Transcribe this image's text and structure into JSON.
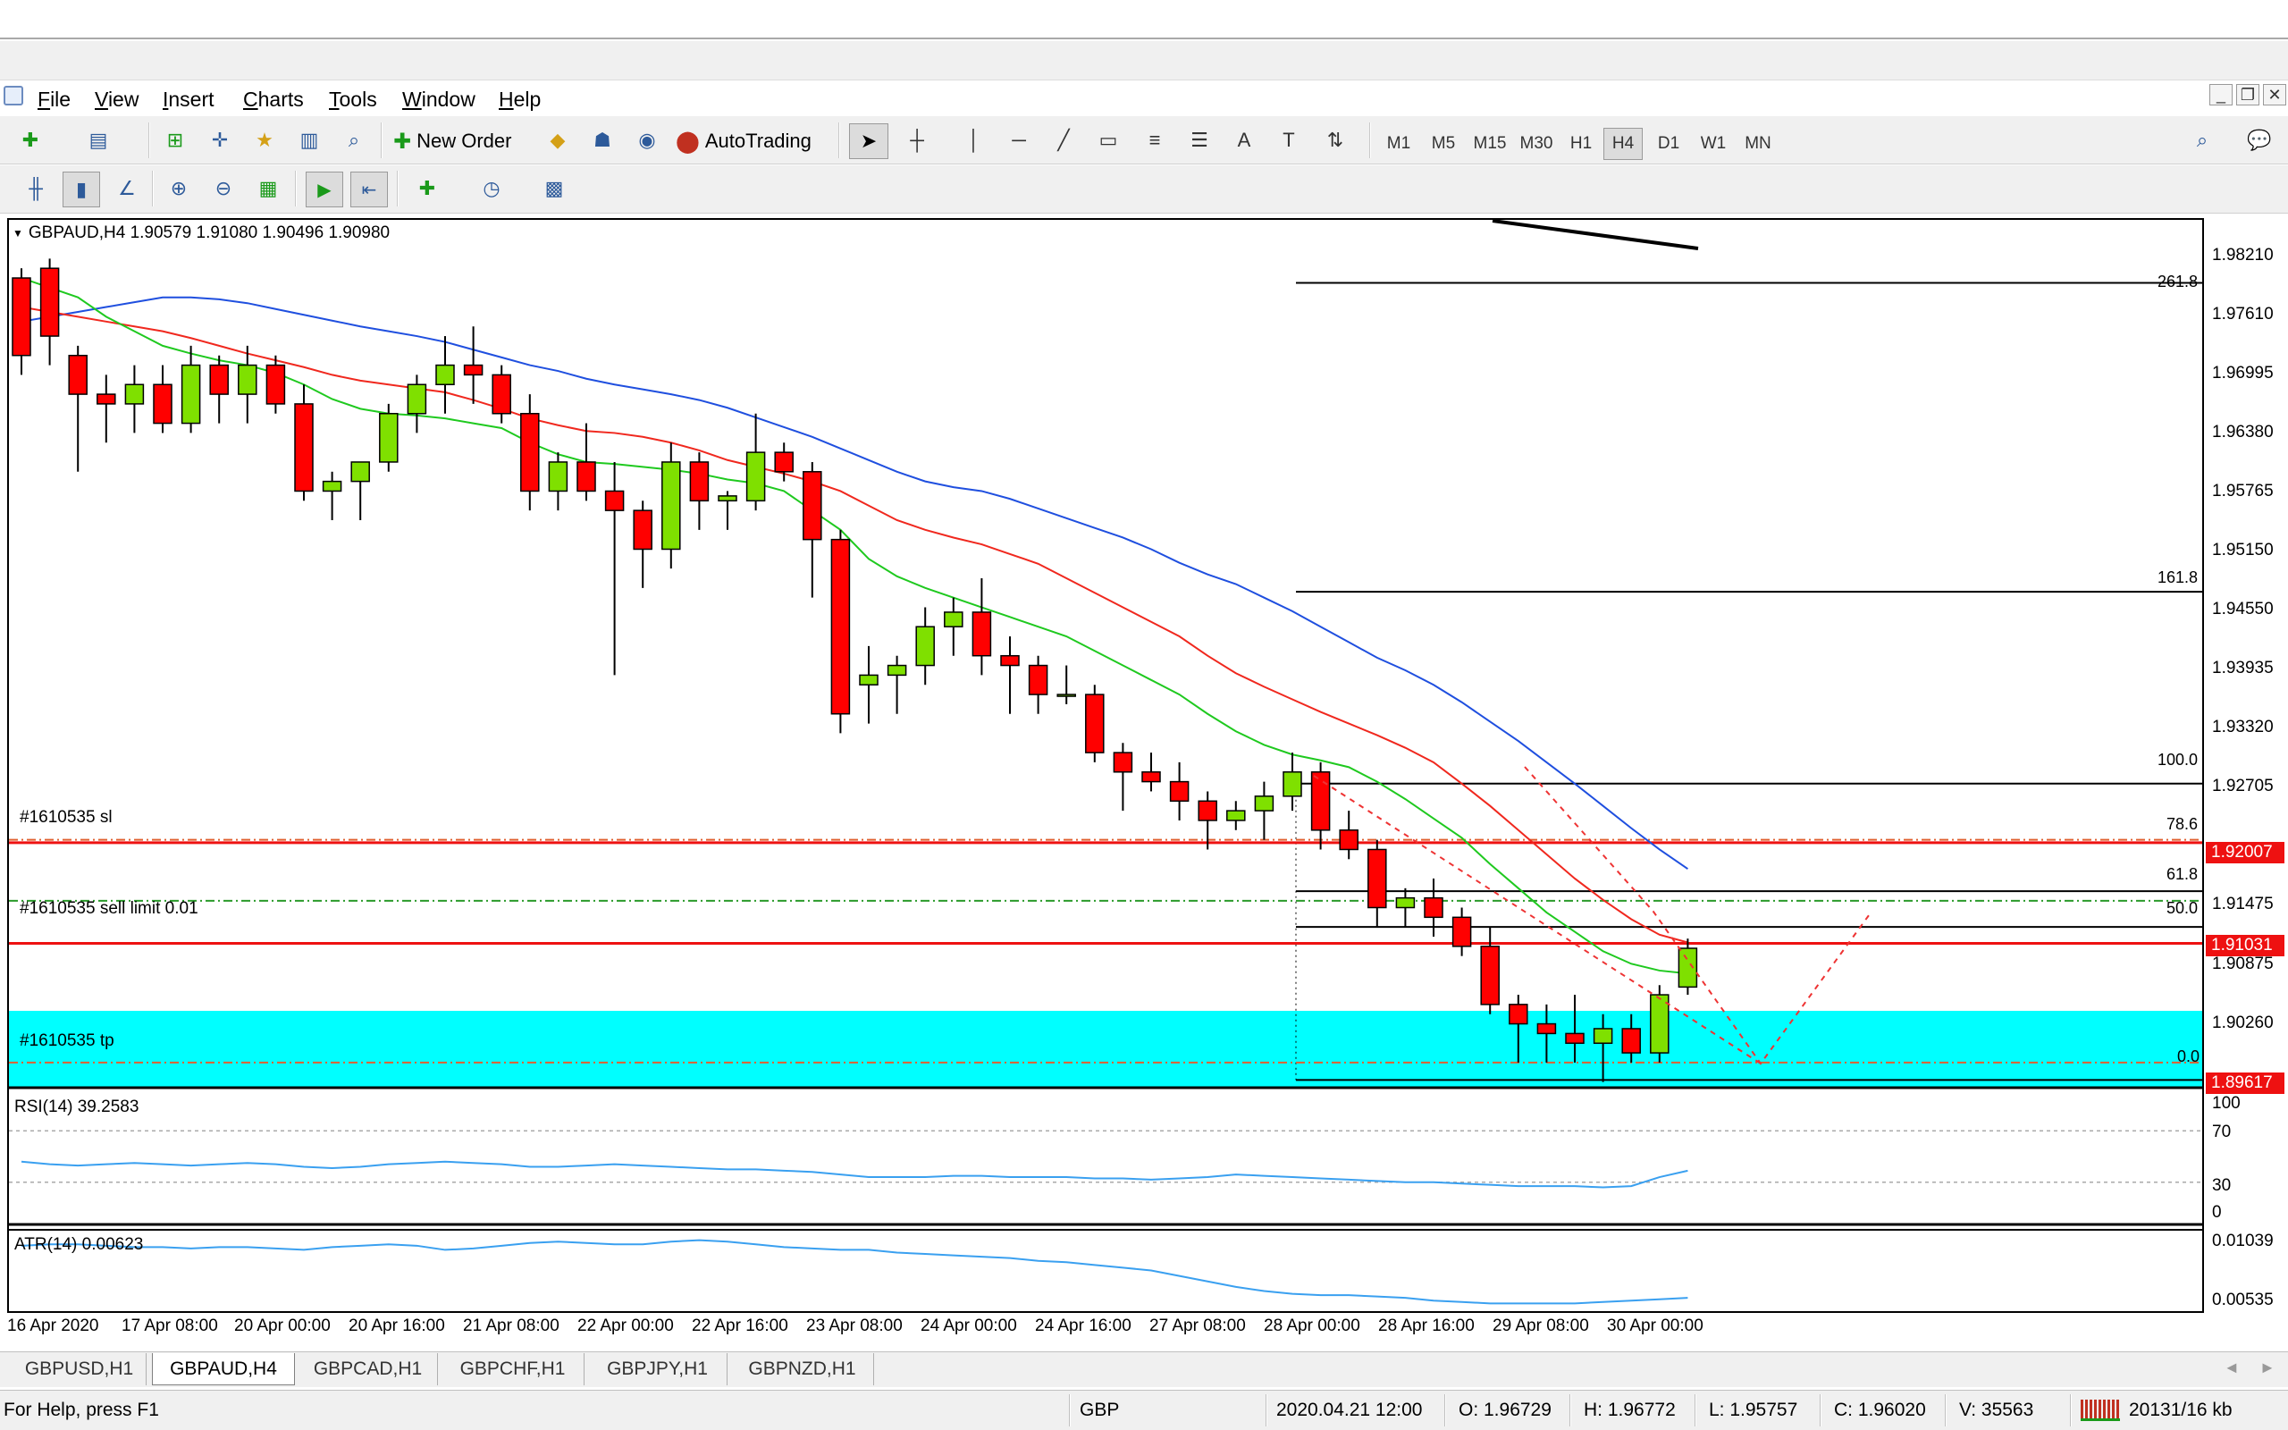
{
  "menu": [
    "File",
    "View",
    "Insert",
    "Charts",
    "Tools",
    "Window",
    "Help"
  ],
  "toolbar": {
    "new_order_label": "New Order",
    "autotrading_label": "AutoTrading",
    "timeframes": [
      "M1",
      "M5",
      "M15",
      "M30",
      "H1",
      "H4",
      "D1",
      "W1",
      "MN"
    ],
    "active_timeframe": "H4"
  },
  "chart": {
    "header": "GBPAUD,H4  1.90579 1.91080 1.90496 1.90980",
    "price_axis": [
      "1.98210",
      "1.97610",
      "1.96995",
      "1.96380",
      "1.95765",
      "1.95150",
      "1.94550",
      "1.93935",
      "1.93320",
      "1.92705",
      "1.92090",
      "1.91475",
      "1.90875",
      "1.90260"
    ],
    "price_tags": {
      "sl": "1.92007",
      "bid": "1.91031",
      "tp": "1.89617"
    },
    "fib_levels": [
      "261.8",
      "161.8",
      "100.0",
      "78.6",
      "61.8",
      "50.0",
      "0.0"
    ],
    "order_labels": {
      "sl": "#1610535 sl",
      "sell_limit": "#1610535 sell limit 0.01",
      "tp": "#1610535 tp"
    },
    "rsi_label": "RSI(14) 39.2583",
    "rsi_axis": [
      "100",
      "70",
      "30",
      "0"
    ],
    "atr_label": "ATR(14) 0.00623",
    "atr_axis": [
      "0.01039",
      "0.00535"
    ],
    "time_axis": [
      "16 Apr 2020",
      "17 Apr 08:00",
      "20 Apr 00:00",
      "20 Apr 16:00",
      "21 Apr 08:00",
      "22 Apr 00:00",
      "22 Apr 16:00",
      "23 Apr 08:00",
      "24 Apr 00:00",
      "24 Apr 16:00",
      "27 Apr 08:00",
      "28 Apr 00:00",
      "28 Apr 16:00",
      "29 Apr 08:00",
      "30 Apr 00:00"
    ]
  },
  "chart_data": {
    "type": "candlestick",
    "symbol": "GBPAUD",
    "timeframe": "H4",
    "ylim": [
      1.8955,
      1.985
    ],
    "candles": [
      [
        1.979,
        1.98,
        1.969,
        1.971
      ],
      [
        1.98,
        1.981,
        1.97,
        1.973
      ],
      [
        1.971,
        1.972,
        1.959,
        1.967
      ],
      [
        1.967,
        1.969,
        1.962,
        1.966
      ],
      [
        1.966,
        1.97,
        1.963,
        1.968
      ],
      [
        1.968,
        1.97,
        1.963,
        1.964
      ],
      [
        1.964,
        1.972,
        1.963,
        1.97
      ],
      [
        1.97,
        1.971,
        1.964,
        1.967
      ],
      [
        1.967,
        1.972,
        1.964,
        1.97
      ],
      [
        1.97,
        1.971,
        1.965,
        1.966
      ],
      [
        1.966,
        1.968,
        1.956,
        1.957
      ],
      [
        1.957,
        1.959,
        1.954,
        1.958
      ],
      [
        1.958,
        1.96,
        1.954,
        1.96
      ],
      [
        1.96,
        1.966,
        1.959,
        1.965
      ],
      [
        1.965,
        1.969,
        1.963,
        1.968
      ],
      [
        1.968,
        1.973,
        1.965,
        1.97
      ],
      [
        1.97,
        1.974,
        1.966,
        1.969
      ],
      [
        1.969,
        1.97,
        1.964,
        1.965
      ],
      [
        1.965,
        1.967,
        1.955,
        1.957
      ],
      [
        1.957,
        1.961,
        1.955,
        1.96
      ],
      [
        1.96,
        1.964,
        1.956,
        1.957
      ],
      [
        1.957,
        1.96,
        1.938,
        1.955
      ],
      [
        1.955,
        1.956,
        1.947,
        1.951
      ],
      [
        1.951,
        1.962,
        1.949,
        1.96
      ],
      [
        1.96,
        1.961,
        1.953,
        1.956
      ],
      [
        1.956,
        1.957,
        1.953,
        1.9565
      ],
      [
        1.956,
        1.965,
        1.955,
        1.961
      ],
      [
        1.961,
        1.962,
        1.958,
        1.959
      ],
      [
        1.959,
        1.96,
        1.946,
        1.952
      ],
      [
        1.952,
        1.953,
        1.932,
        1.934
      ],
      [
        1.937,
        1.941,
        1.933,
        1.938
      ],
      [
        1.938,
        1.94,
        1.934,
        1.939
      ],
      [
        1.939,
        1.945,
        1.937,
        1.943
      ],
      [
        1.943,
        1.946,
        1.94,
        1.9445
      ],
      [
        1.9445,
        1.948,
        1.938,
        1.94
      ],
      [
        1.94,
        1.942,
        1.934,
        1.939
      ],
      [
        1.939,
        1.94,
        1.934,
        1.936
      ],
      [
        1.936,
        1.939,
        1.935,
        1.936
      ],
      [
        1.936,
        1.937,
        1.929,
        1.93
      ],
      [
        1.93,
        1.931,
        1.924,
        1.928
      ],
      [
        1.928,
        1.93,
        1.926,
        1.927
      ],
      [
        1.927,
        1.929,
        1.923,
        1.925
      ],
      [
        1.925,
        1.926,
        1.92,
        1.923
      ],
      [
        1.923,
        1.925,
        1.922,
        1.924
      ],
      [
        1.924,
        1.927,
        1.921,
        1.9255
      ],
      [
        1.9255,
        1.93,
        1.924,
        1.928
      ],
      [
        1.928,
        1.929,
        1.92,
        1.922
      ],
      [
        1.922,
        1.924,
        1.919,
        1.92
      ],
      [
        1.92,
        1.921,
        1.912,
        1.914
      ],
      [
        1.914,
        1.916,
        1.912,
        1.915
      ],
      [
        1.915,
        1.917,
        1.911,
        1.913
      ],
      [
        1.913,
        1.914,
        1.909,
        1.91
      ],
      [
        1.91,
        1.912,
        1.903,
        1.904
      ],
      [
        1.904,
        1.905,
        1.898,
        1.902
      ],
      [
        1.902,
        1.904,
        1.898,
        1.901
      ],
      [
        1.901,
        1.905,
        1.898,
        1.9
      ],
      [
        1.9,
        1.903,
        1.896,
        1.9015
      ],
      [
        1.9015,
        1.903,
        1.898,
        1.899
      ],
      [
        1.899,
        1.906,
        1.898,
        1.905
      ],
      [
        1.9058,
        1.9108,
        1.905,
        1.9098
      ]
    ],
    "ma_green": [
      1.979,
      1.978,
      1.977,
      1.975,
      1.9735,
      1.972,
      1.9712,
      1.9705,
      1.97,
      1.9692,
      1.968,
      1.9665,
      1.9655,
      1.965,
      1.9648,
      1.9645,
      1.964,
      1.9635,
      1.962,
      1.9608,
      1.96,
      1.9598,
      1.9595,
      1.9592,
      1.9588,
      1.9582,
      1.9578,
      1.957,
      1.955,
      1.953,
      1.95,
      1.9482,
      1.947,
      1.946,
      1.945,
      1.944,
      1.943,
      1.942,
      1.9405,
      1.939,
      1.9375,
      1.936,
      1.934,
      1.9322,
      1.9308,
      1.9298,
      1.9292,
      1.9285,
      1.927,
      1.9252,
      1.9232,
      1.9212,
      1.9185,
      1.916,
      1.9135,
      1.9115,
      1.9095,
      1.9082,
      1.9075,
      1.9072
    ],
    "ma_red": [
      1.976,
      1.9755,
      1.975,
      1.9745,
      1.974,
      1.9735,
      1.9728,
      1.972,
      1.9712,
      1.9705,
      1.9698,
      1.969,
      1.9684,
      1.968,
      1.9676,
      1.9672,
      1.9664,
      1.9655,
      1.9645,
      1.9638,
      1.9632,
      1.963,
      1.9626,
      1.962,
      1.9612,
      1.9602,
      1.9595,
      1.9588,
      1.958,
      1.957,
      1.9555,
      1.954,
      1.953,
      1.9522,
      1.9515,
      1.9505,
      1.9495,
      1.948,
      1.9465,
      1.945,
      1.9435,
      1.942,
      1.94,
      1.9382,
      1.9368,
      1.9355,
      1.9342,
      1.933,
      1.9318,
      1.9305,
      1.929,
      1.9268,
      1.9245,
      1.922,
      1.9195,
      1.917,
      1.9148,
      1.9128,
      1.9112,
      1.9104
    ],
    "ma_blue": [
      1.9745,
      1.975,
      1.9755,
      1.976,
      1.9765,
      1.977,
      1.977,
      1.9768,
      1.9764,
      1.9758,
      1.9752,
      1.9746,
      1.974,
      1.9735,
      1.973,
      1.9724,
      1.9716,
      1.9708,
      1.97,
      1.9694,
      1.9686,
      1.968,
      1.9675,
      1.967,
      1.9664,
      1.9656,
      1.9646,
      1.9636,
      1.9626,
      1.9614,
      1.9602,
      1.959,
      1.958,
      1.9574,
      1.957,
      1.9562,
      1.9552,
      1.9542,
      1.9532,
      1.9522,
      1.951,
      1.9496,
      1.9484,
      1.9474,
      1.946,
      1.9446,
      1.943,
      1.9414,
      1.9398,
      1.9385,
      1.937,
      1.9352,
      1.9332,
      1.9312,
      1.929,
      1.9268,
      1.9245,
      1.9222,
      1.92,
      1.918
    ],
    "rsi": [
      46,
      44,
      43,
      44,
      45,
      44,
      43,
      44,
      45,
      44,
      42,
      41,
      42,
      44,
      45,
      46,
      45,
      44,
      42,
      42,
      43,
      44,
      43,
      42,
      41,
      40,
      40,
      39,
      38,
      36,
      34,
      34,
      34,
      35,
      35,
      34,
      34,
      34,
      33,
      33,
      32,
      33,
      34,
      36,
      35,
      34,
      33,
      32,
      31,
      30,
      30,
      29,
      28,
      27,
      27,
      27,
      26,
      27,
      34,
      39
    ],
    "atr": [
      0.0097,
      0.0098,
      0.0098,
      0.0097,
      0.0096,
      0.0096,
      0.0095,
      0.0096,
      0.0096,
      0.0095,
      0.0094,
      0.0096,
      0.0097,
      0.0098,
      0.0097,
      0.0094,
      0.0095,
      0.0097,
      0.0099,
      0.01,
      0.0099,
      0.0098,
      0.0098,
      0.01,
      0.0101,
      0.01,
      0.0098,
      0.0096,
      0.0095,
      0.0094,
      0.0094,
      0.0092,
      0.0091,
      0.009,
      0.0089,
      0.0088,
      0.0086,
      0.0085,
      0.0083,
      0.0081,
      0.0079,
      0.0075,
      0.0071,
      0.0067,
      0.0064,
      0.0062,
      0.0061,
      0.0061,
      0.006,
      0.0059,
      0.0057,
      0.0056,
      0.0055,
      0.0055,
      0.0055,
      0.0055,
      0.0056,
      0.0057,
      0.0058,
      0.0059
    ],
    "levels": {
      "sl": 1.9207,
      "sell_limit": 1.9147,
      "bid": 1.91031,
      "tp": 1.898,
      "fib_261_8": 1.9785,
      "fib_161_8": 1.9466,
      "fib_100": 1.9268,
      "fib_78_6": 1.921,
      "fib_61_8": 1.9157,
      "fib_50": 1.912,
      "fib_0": 1.8962
    },
    "colors": {
      "bull": "#7fe000",
      "bear": "#ff0000",
      "ma_green": "#1fc91f",
      "ma_red": "#f0281e",
      "ma_blue": "#1f4fdf",
      "tp_zone": "#00ffff",
      "rsi_line": "#3aa0f0"
    }
  },
  "tabs": [
    "GBPUSD,H1",
    "GBPAUD,H4",
    "GBPCAD,H1",
    "GBPCHF,H1",
    "GBPJPY,H1",
    "GBPNZD,H1"
  ],
  "active_tab": "GBPAUD,H4",
  "status": {
    "help": "For Help, press F1",
    "profile": "GBP",
    "time": "2020.04.21 12:00",
    "open": "O: 1.96729",
    "high": "H: 1.96772",
    "low": "L: 1.95757",
    "close": "C: 1.96020",
    "volume": "V: 35563",
    "traffic": "20131/16 kb"
  }
}
